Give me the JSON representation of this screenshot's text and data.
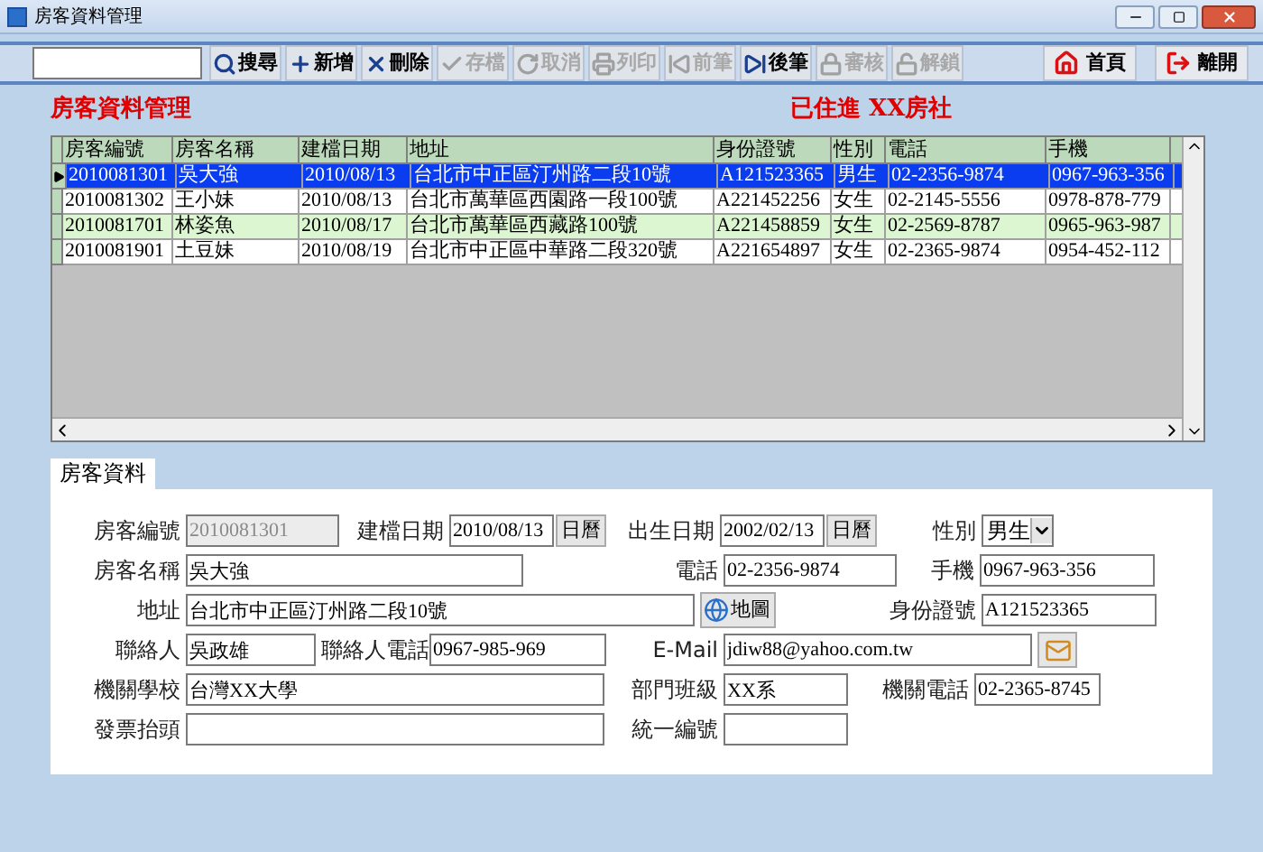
{
  "window": {
    "title": "房客資料管理"
  },
  "toolbar": {
    "buttons": [
      {
        "label": "搜尋",
        "disabled": false
      },
      {
        "label": "新增",
        "disabled": false
      },
      {
        "label": "刪除",
        "disabled": false
      },
      {
        "label": "存檔",
        "disabled": true
      },
      {
        "label": "取消",
        "disabled": true
      },
      {
        "label": "列印",
        "disabled": true
      },
      {
        "label": "前筆",
        "disabled": true
      },
      {
        "label": "後筆",
        "disabled": false
      },
      {
        "label": "審核",
        "disabled": true
      },
      {
        "label": "解鎖",
        "disabled": true
      }
    ],
    "nav_buttons": [
      {
        "label": "首頁"
      },
      {
        "label": "離開"
      }
    ]
  },
  "heading": "房客資料管理",
  "status": "已住進 XX房社",
  "table": {
    "columns": [
      "房客編號",
      "房客名稱",
      "建檔日期",
      "地址",
      "身份證號",
      "性別",
      "電話",
      "手機"
    ],
    "rows": [
      {
        "selected": true,
        "cells": [
          "2010081301",
          "吳大強",
          "2010/08/13",
          "台北市中正區汀州路二段10號",
          "A121523365",
          "男生",
          "02-2356-9874",
          "0967-963-356"
        ]
      },
      {
        "selected": false,
        "cells": [
          "2010081302",
          "王小妹",
          "2010/08/13",
          "台北市萬華區西園路一段100號",
          "A221452256",
          "女生",
          "02-2145-5556",
          "0978-878-779"
        ]
      },
      {
        "selected": false,
        "cells": [
          "2010081701",
          "林姿魚",
          "2010/08/17",
          "台北市萬華區西藏路100號",
          "A221458859",
          "女生",
          "02-2569-8787",
          "0965-963-987"
        ]
      },
      {
        "selected": false,
        "cells": [
          "2010081901",
          "土豆妹",
          "2010/08/19",
          "台北市中正區中華路二段320號",
          "A221654897",
          "女生",
          "02-2365-9874",
          "0954-452-112"
        ]
      }
    ]
  },
  "tabs": [
    {
      "label": "房客資料",
      "selected": true
    }
  ],
  "form": {
    "rows": [
      [
        {
          "kind": "text",
          "label": "房客編號",
          "value": "2010081301",
          "disabled": true
        },
        {
          "kind": "date",
          "label": "建檔日期",
          "value": "2010/08/13",
          "button": "日曆"
        },
        {
          "kind": "date",
          "label": "出生日期",
          "value": "2002/02/13",
          "button": "日曆"
        },
        {
          "kind": "select",
          "label": "性別",
          "value": "男生"
        }
      ],
      [
        {
          "kind": "text",
          "label": "房客名稱",
          "value": "吳大強",
          "disabled": false
        },
        {
          "kind": "text",
          "label": "電話",
          "value": "02-2356-9874",
          "disabled": false
        },
        {
          "kind": "text",
          "label": "手機",
          "value": "0967-963-356",
          "disabled": false
        }
      ],
      [
        {
          "kind": "map",
          "label": "地址",
          "value": "台北市中正區汀州路二段10號",
          "button": "地圖"
        },
        null,
        {
          "kind": "text",
          "label": "身份證號",
          "value": "A121523365",
          "disabled": false
        }
      ],
      [
        {
          "kind": "text",
          "label": "聯絡人",
          "value": "吳政雄",
          "disabled": false
        },
        {
          "kind": "text",
          "label": "聯絡人電話",
          "value": "0967-985-969",
          "disabled": false
        },
        {
          "kind": "email",
          "label": "E-Mail",
          "value": "jdiw88@yahoo.com.tw"
        }
      ],
      [
        {
          "kind": "text",
          "label": "機關學校",
          "value": "台灣XX大學",
          "disabled": false
        },
        {
          "kind": "text",
          "label": "部門班級",
          "value": "XX系",
          "disabled": false
        },
        {
          "kind": "text",
          "label": "機關電話",
          "value": "02-2365-8745",
          "disabled": false
        }
      ],
      [
        {
          "kind": "text",
          "label": "發票抬頭",
          "disabled": false
        },
        {
          "kind": "text",
          "label": "統一編號",
          "disabled": false
        }
      ]
    ]
  }
}
